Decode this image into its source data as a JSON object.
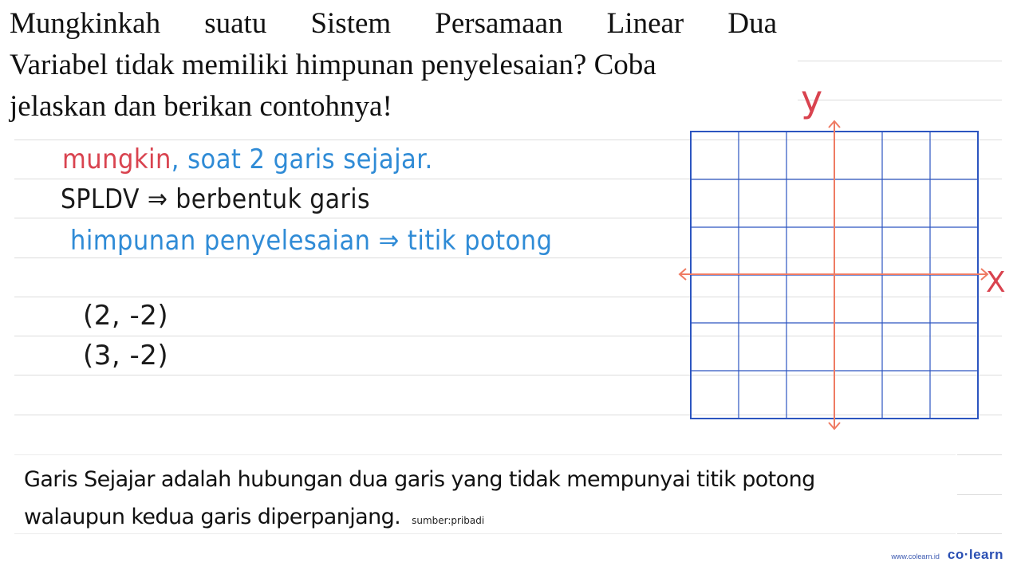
{
  "question": {
    "lines": [
      "Mungkinkah suatu Sistem Persamaan Linear Dua",
      "Variabel tidak memiliki himpunan penyelesaian? Coba",
      "jelaskan dan berikan contohnya!"
    ]
  },
  "answer": {
    "line1_red": "mungkin",
    "line1_blue": ", soat 2 garis sejajar.",
    "line2": "SPLDV ⇒ berbentuk garis",
    "line3": "himpunan penyelesaian ⇒ titik potong",
    "points": [
      "(2, -2)",
      "(3, -2)"
    ]
  },
  "graph": {
    "x_label": "X",
    "y_label": "y",
    "grid_divisions": 6,
    "colors": {
      "grid": "#2c55c0",
      "axes": "#ef7b63",
      "labels": "#d9434f"
    }
  },
  "note": {
    "line1": "Garis Sejajar adalah hubungan dua garis yang tidak mempunyai titik potong",
    "line2": "walaupun kedua garis diperpanjang.",
    "source": "sumber:pribadi"
  },
  "brand": {
    "url": "www.colearn.id",
    "logo": "co·learn"
  },
  "colors": {
    "red_ink": "#d9434f",
    "blue_ink": "#2f8bd6",
    "black_ink": "#1a1a1a",
    "rule": "#dcdcdc"
  }
}
